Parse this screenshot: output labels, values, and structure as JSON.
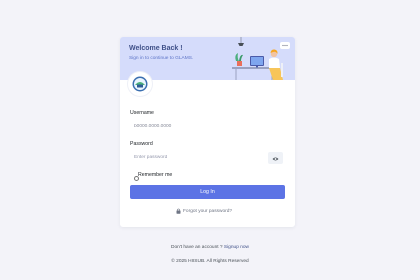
{
  "header": {
    "title": "Welcome Back !",
    "subtitle": "Sign in to continue to GLAMS."
  },
  "form": {
    "username_label": "Username",
    "username_value": "b0000.0000.0000",
    "password_label": "Password",
    "password_placeholder": "Enter password",
    "remember_label": "Remember me",
    "login_button": "Log In",
    "forgot_link": "Forgot your password?"
  },
  "signup": {
    "prompt": "Don't have an account ? ",
    "link": "Signup now"
  },
  "footer": {
    "copyright": "© 2025 HIISUB. All Rights Reserved"
  },
  "colors": {
    "primary": "#5c73e5",
    "banner": "#d5dcfb",
    "title": "#405189"
  },
  "icons": {
    "logo": "logo-icon",
    "eye": "eye-icon",
    "lock": "lock-icon"
  }
}
